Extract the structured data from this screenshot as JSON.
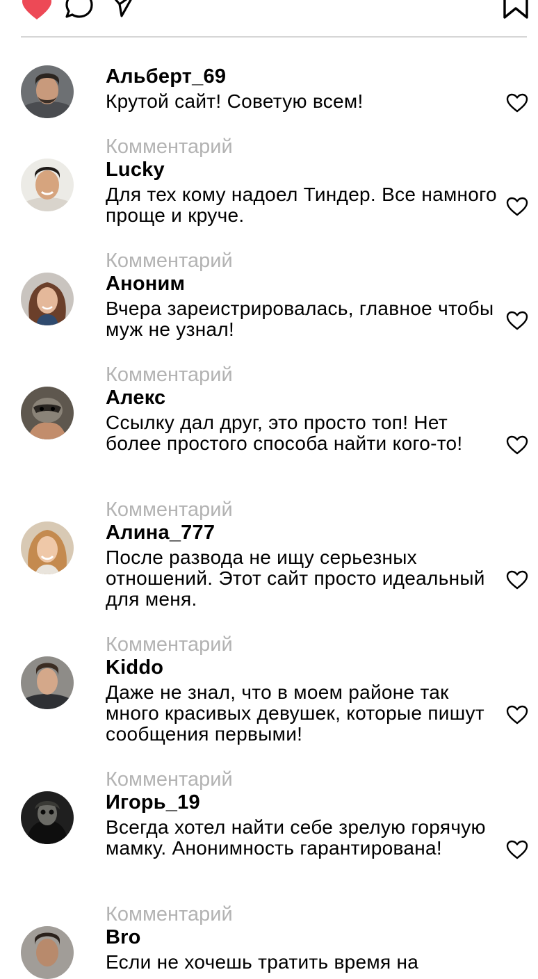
{
  "toolbar": {
    "icons": [
      "heart-filled-icon",
      "comment-icon",
      "share-icon",
      "bookmark-icon"
    ],
    "accent_color": "#ed4956"
  },
  "comments": [
    {
      "label": "",
      "user": "Альберт_69",
      "text": "Крутой сайт! Советую всем!",
      "avatar": "avatar-man-beard"
    },
    {
      "label": "Комментарий",
      "user": "Lucky",
      "text": "Для тех кому надоел Тиндер. Все намного проще и круче.",
      "avatar": "avatar-man-smiling"
    },
    {
      "label": "Комментарий",
      "user": "Аноним",
      "text": "Вчера зареистрировалась, главное чтобы муж не узнал!",
      "avatar": "avatar-woman-brunette"
    },
    {
      "label": "Комментарий",
      "user": "Алекс",
      "text": "Ссылку дал друг, это просто топ! Нет более простого способа найти кого-то!",
      "avatar": "avatar-raccoon"
    },
    {
      "label": "Комментарий",
      "user": "Алина_777",
      "text": "После развода не ищу серьезных отношений. Этот сайт просто идеальный для меня.",
      "avatar": "avatar-woman-blonde"
    },
    {
      "label": "Комментарий",
      "user": "Kiddo",
      "text": "Даже не знал, что в моем районе так много красивых девушек, которые пишут сообщения первыми!",
      "avatar": "avatar-man-young"
    },
    {
      "label": "Комментарий",
      "user": "Игорь_19",
      "text": "Всегда хотел найти себе зрелую горячую мамку. Анонимность гарантирована!",
      "avatar": "avatar-skull-dark"
    },
    {
      "label": "Комментарий",
      "user": "Bro",
      "text": "Если не хочешь тратить время на",
      "avatar": "avatar-man-stubble"
    }
  ]
}
